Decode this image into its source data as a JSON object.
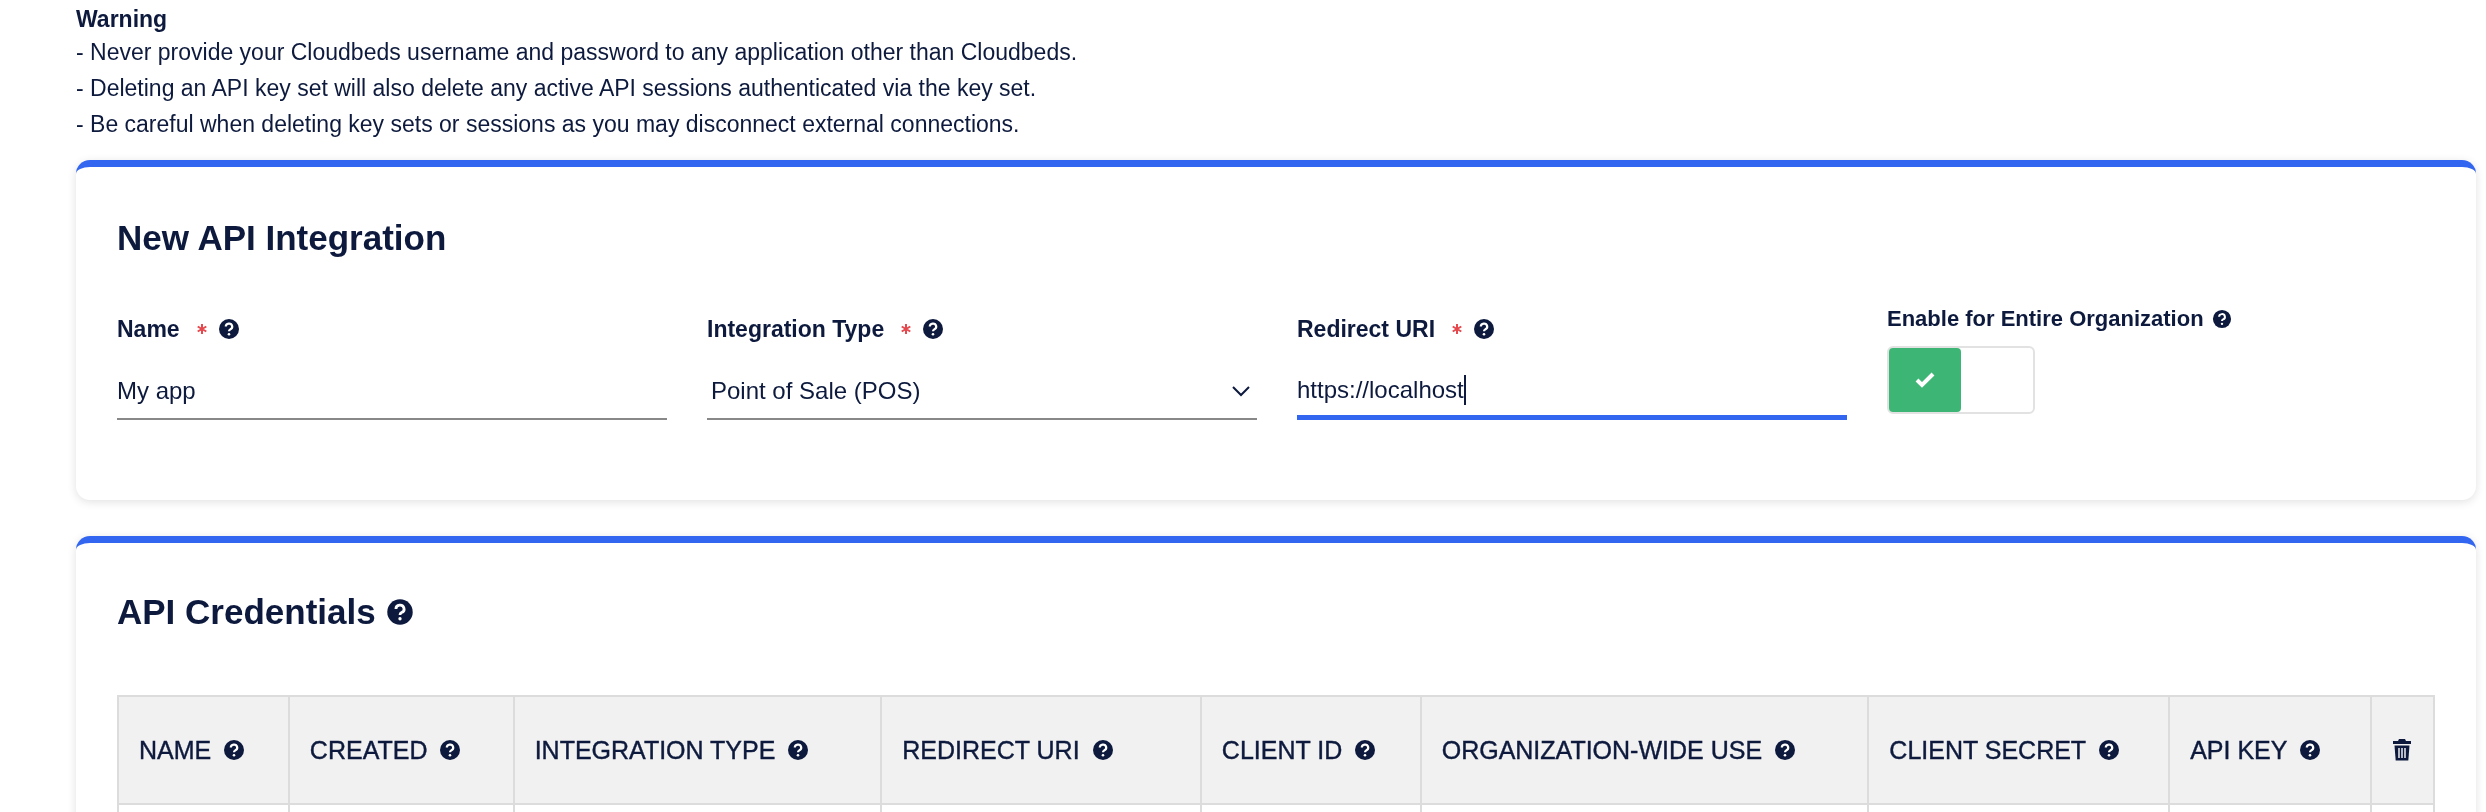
{
  "warning": {
    "title": "Warning",
    "lines": [
      "- Never provide your Cloudbeds username and password to any application other than Cloudbeds.",
      "- Deleting an API key set will also delete any active API sessions authenticated via the key set.",
      "- Be careful when deleting key sets or sessions as you may disconnect external connections."
    ]
  },
  "new_integration": {
    "title": "New API Integration",
    "fields": [
      {
        "kind": "text",
        "label": "Name",
        "required": true,
        "value": "My app",
        "focused": false
      },
      {
        "kind": "select",
        "label": "Integration Type",
        "required": true,
        "value": "Point of Sale (POS)",
        "focused": false
      },
      {
        "kind": "text",
        "label": "Redirect URI",
        "required": true,
        "value": "https://localhost",
        "focused": true
      }
    ],
    "toggle": {
      "label": "Enable for Entire Organization",
      "on": true
    }
  },
  "credentials": {
    "title": "API Credentials",
    "columns": [
      {
        "kind": "text",
        "label": "NAME"
      },
      {
        "kind": "text",
        "label": "CREATED"
      },
      {
        "kind": "text",
        "label": "INTEGRATION TYPE"
      },
      {
        "kind": "text",
        "label": "REDIRECT URI"
      },
      {
        "kind": "text",
        "label": "CLIENT ID"
      },
      {
        "kind": "text",
        "label": "ORGANIZATION-WIDE USE"
      },
      {
        "kind": "text",
        "label": "CLIENT SECRET"
      },
      {
        "kind": "text",
        "label": "API KEY"
      },
      {
        "kind": "delete"
      }
    ]
  }
}
